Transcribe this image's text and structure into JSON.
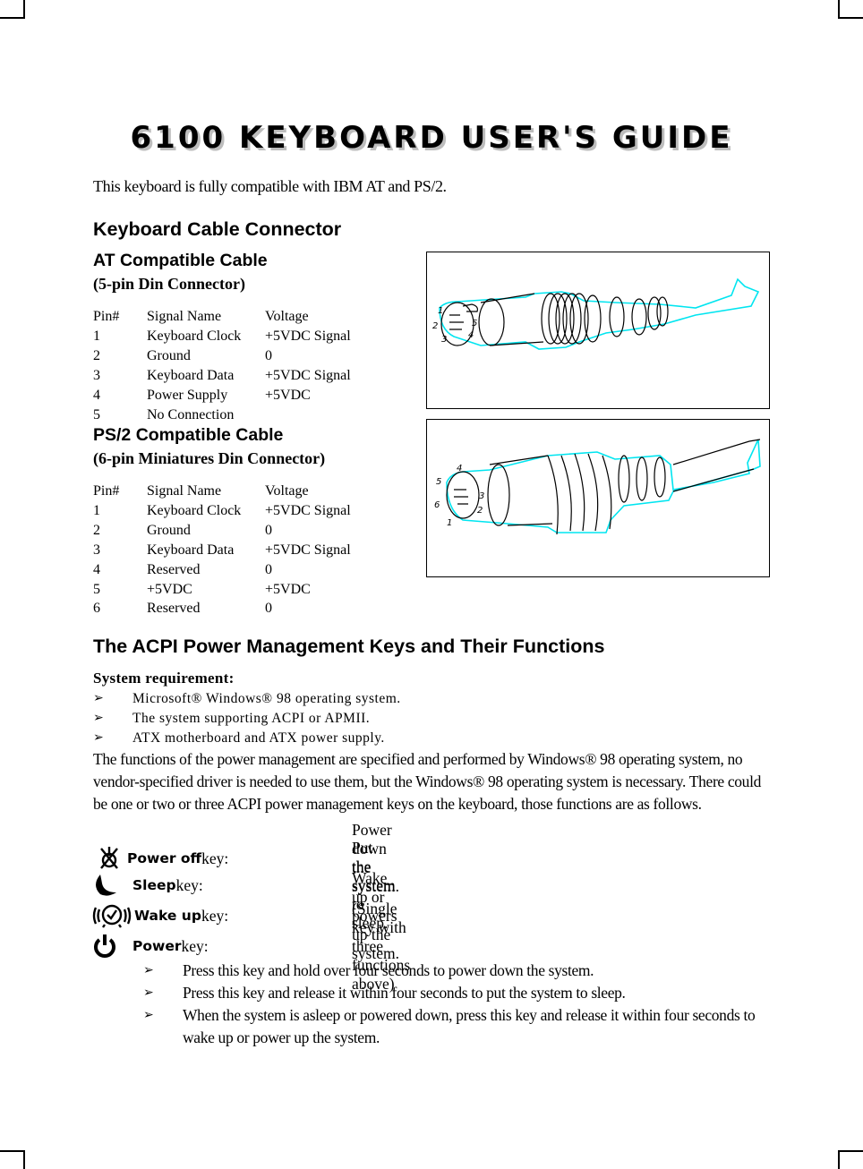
{
  "title": "6100 KEYBOARD USER'S GUIDE",
  "intro": "This keyboard is fully compatible with IBM AT and PS/2.",
  "section_cable": {
    "heading": "Keyboard Cable Connector",
    "at": {
      "heading": "AT Compatible Cable",
      "subheading": "(5-pin Din Connector)",
      "columns": [
        "Pin#",
        "Signal Name",
        "Voltage"
      ],
      "rows": [
        [
          "1",
          "Keyboard Clock",
          "+5VDC Signal"
        ],
        [
          "2",
          "Ground",
          "0"
        ],
        [
          "3",
          "Keyboard Data",
          "+5VDC Signal"
        ],
        [
          "4",
          "Power Supply",
          "+5VDC"
        ],
        [
          "5",
          "No Connection",
          ""
        ]
      ],
      "figure_pin_labels": [
        "1",
        "2",
        "3",
        "4",
        "5"
      ]
    },
    "ps2": {
      "heading": "PS/2 Compatible Cable",
      "subheading": "(6-pin Miniatures Din Connector)",
      "columns": [
        "Pin#",
        "Signal Name",
        "Voltage"
      ],
      "rows": [
        [
          "1",
          "Keyboard Clock",
          "+5VDC Signal"
        ],
        [
          "2",
          "Ground",
          "0"
        ],
        [
          "3",
          "Keyboard Data",
          "+5VDC Signal"
        ],
        [
          "4",
          "Reserved",
          "0"
        ],
        [
          "5",
          "+5VDC",
          "+5VDC"
        ],
        [
          "6",
          "Reserved",
          "0"
        ]
      ],
      "figure_pin_labels": [
        "1",
        "2",
        "3",
        "4",
        "5",
        "6"
      ]
    },
    "figure_outline_color": "#00e5f0"
  },
  "section_acpi": {
    "heading": "The ACPI Power Management Keys and Their Functions",
    "requirement_title": "System requirement:",
    "requirements": [
      "Microsoft® Windows® 98 operating system.",
      "The system supporting ACPI or APMII.",
      "ATX motherboard and ATX power supply."
    ],
    "paragraph": "The functions of the power management are specified and performed by Windows® 98 operating system, no vendor-specified driver is needed to use them, but the Windows® 98 operating system is necessary. There could be one or two or three ACPI power management keys on the keyboard, those functions are as follows.",
    "keys": [
      {
        "icon": "power-off-icon",
        "name": "Power off",
        "suffix": " key:",
        "desc": "Power down the system."
      },
      {
        "icon": "sleep-moon-icon",
        "name": "Sleep",
        "suffix": " key:",
        "desc": "Put the system to sleep."
      },
      {
        "icon": "wake-up-alarm-icon",
        "name": "Wake up",
        "suffix": " key:",
        "desc": "Wake up or powers up the system."
      },
      {
        "icon": "power-button-icon",
        "name": "Power",
        "suffix": " key:",
        "desc": "(Single key with three functions above)"
      }
    ],
    "power_key_notes": [
      "Press this key and hold over four seconds to power down the system.",
      "Press this key and release it within four seconds to put the system to sleep.",
      "When the system is asleep or powered down, press this key and release it within four seconds to wake up or power up the system."
    ]
  }
}
